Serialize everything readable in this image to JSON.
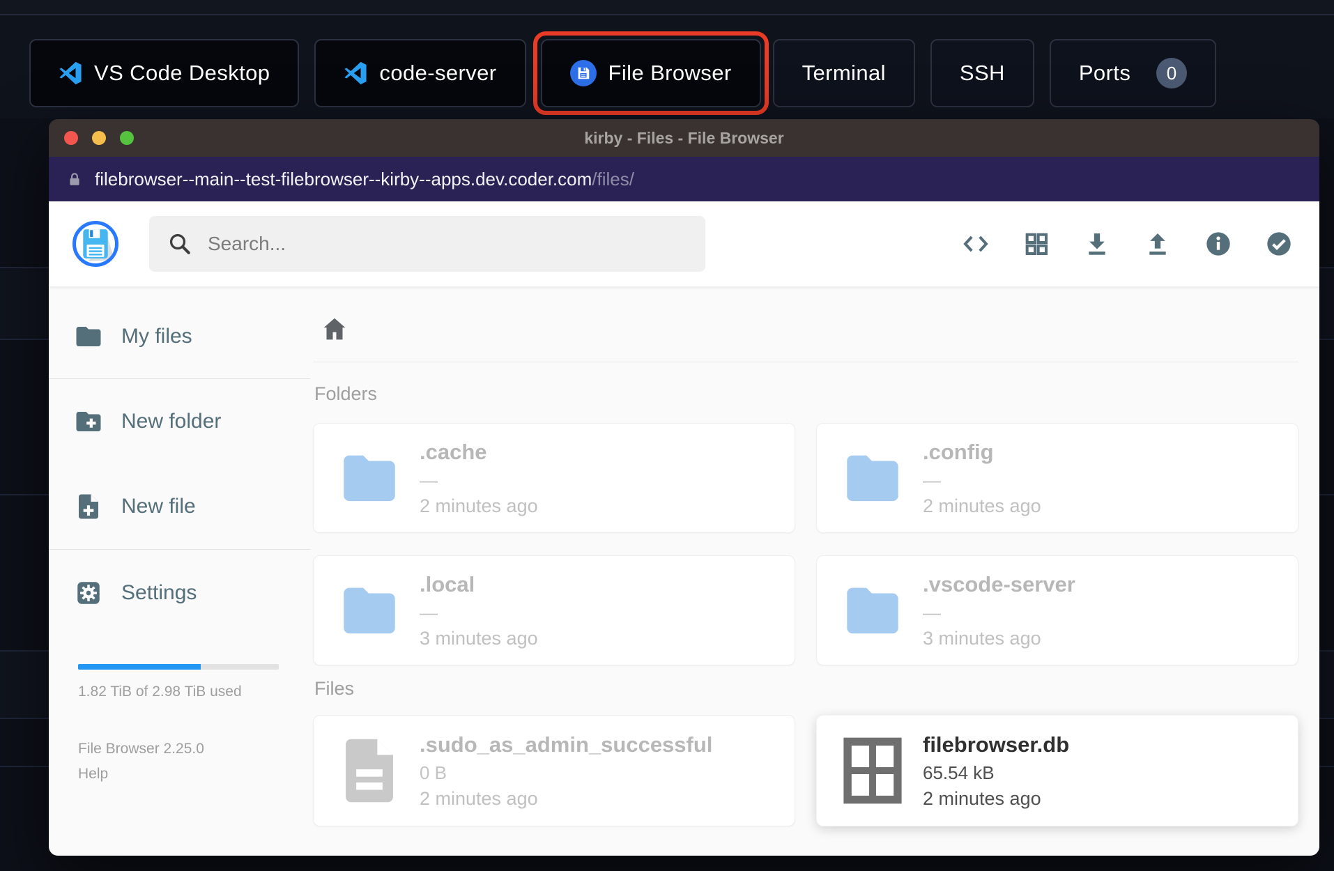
{
  "launcher": {
    "buttons": [
      {
        "label": "VS Code Desktop",
        "icon": "vscode-icon"
      },
      {
        "label": "code-server",
        "icon": "vscode-icon"
      },
      {
        "label": "File Browser",
        "icon": "filebrowser-floppy-icon",
        "active": true
      },
      {
        "label": "Terminal"
      },
      {
        "label": "SSH"
      },
      {
        "label": "Ports",
        "badge": "0"
      }
    ]
  },
  "window": {
    "title": "kirby - Files - File Browser",
    "url": {
      "host": "filebrowser--main--test-filebrowser--kirby--apps.dev.coder.com",
      "path": "/files/"
    }
  },
  "header": {
    "search_placeholder": "Search...",
    "action_icons": [
      "code-icon",
      "grid-view-icon",
      "download-icon",
      "upload-icon",
      "info-icon",
      "check-circle-icon"
    ]
  },
  "sidebar": {
    "items": [
      {
        "label": "My files",
        "icon": "folder-icon"
      },
      {
        "label": "New folder",
        "icon": "folder-plus-icon"
      },
      {
        "label": "New file",
        "icon": "file-plus-icon"
      },
      {
        "label": "Settings",
        "icon": "gear-icon"
      }
    ],
    "usage": {
      "text": "1.82 TiB of 2.98 TiB used",
      "percent": 61,
      "fill_style": "width:61%"
    },
    "version": "File Browser 2.25.0",
    "help": "Help"
  },
  "main": {
    "sections": [
      {
        "title": "Folders",
        "items": [
          {
            "name": ".cache",
            "size": "—",
            "time": "2 minutes ago",
            "type": "folder",
            "muted": true
          },
          {
            "name": ".config",
            "size": "—",
            "time": "2 minutes ago",
            "type": "folder",
            "muted": true
          },
          {
            "name": ".local",
            "size": "—",
            "time": "3 minutes ago",
            "type": "folder",
            "muted": true
          },
          {
            "name": ".vscode-server",
            "size": "—",
            "time": "3 minutes ago",
            "type": "folder",
            "muted": true
          }
        ]
      },
      {
        "title": "Files",
        "items": [
          {
            "name": ".sudo_as_admin_successful",
            "size": "0 B",
            "time": "2 minutes ago",
            "type": "file",
            "muted": true
          },
          {
            "name": "filebrowser.db",
            "size": "65.54 kB",
            "time": "2 minutes ago",
            "type": "database",
            "muted": false
          }
        ]
      }
    ]
  },
  "colors": {
    "topbar_bg": "#0f131c",
    "launcher_button_bg": "#05070c",
    "highlight_red": "#e93b25",
    "titlebar_bg": "#393231",
    "urlbar_bg": "#2a2154",
    "accent_blue": "#2979ff",
    "slate_icon": "#546e7a",
    "folder_blue": "#a6cbf0",
    "progress_blue": "#2196f3",
    "traffic_red": "#f2564e",
    "traffic_yellow": "#f5bd4b",
    "traffic_green": "#55c33d"
  }
}
